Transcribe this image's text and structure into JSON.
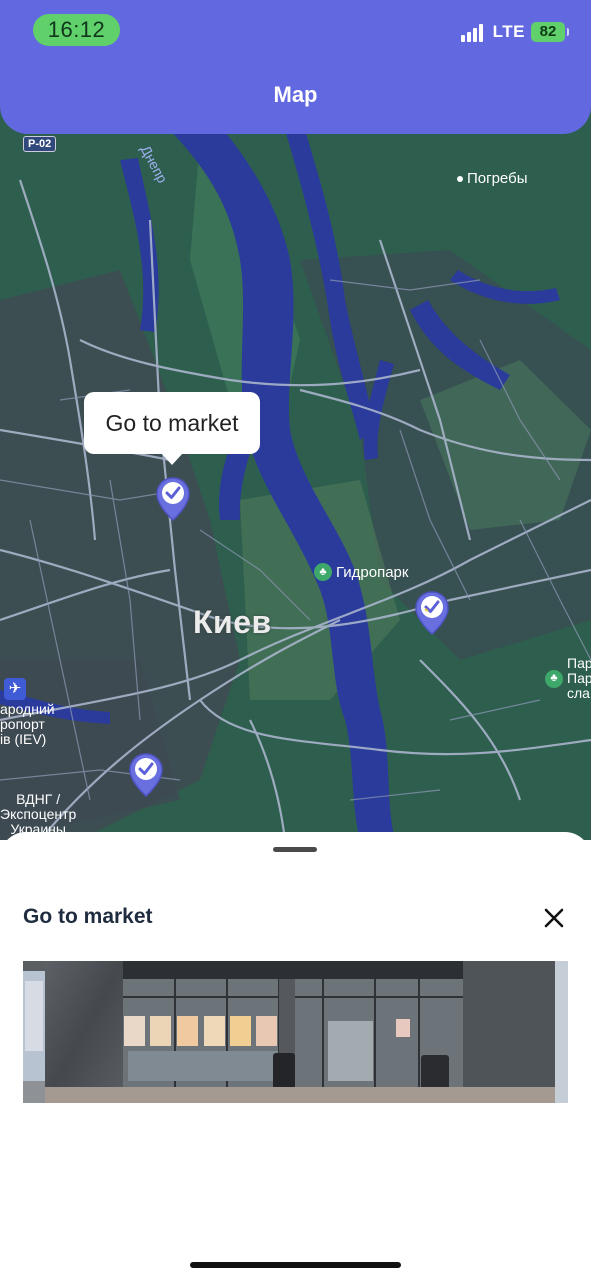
{
  "status_bar": {
    "time": "16:12",
    "network": "LTE",
    "battery": "82"
  },
  "header": {
    "title": "Map"
  },
  "map": {
    "road_badge": "P-02",
    "labels": {
      "river": "Днепр",
      "village": "Погребы",
      "city": "Киев",
      "park": "Гидропарк",
      "right_park": "Пар\nПар\nсла",
      "airport": "ародний\nропорт\nів (IEV)",
      "expo": "ВДНГ /\nЭкспоцентр\nУкраины"
    },
    "tooltip": "Go to market",
    "pins": [
      "market-pin",
      "market-pin",
      "market-pin"
    ]
  },
  "sheet": {
    "title": "Go to market",
    "close_icon": "close-icon",
    "photo_alt": "store-front-photo"
  }
}
